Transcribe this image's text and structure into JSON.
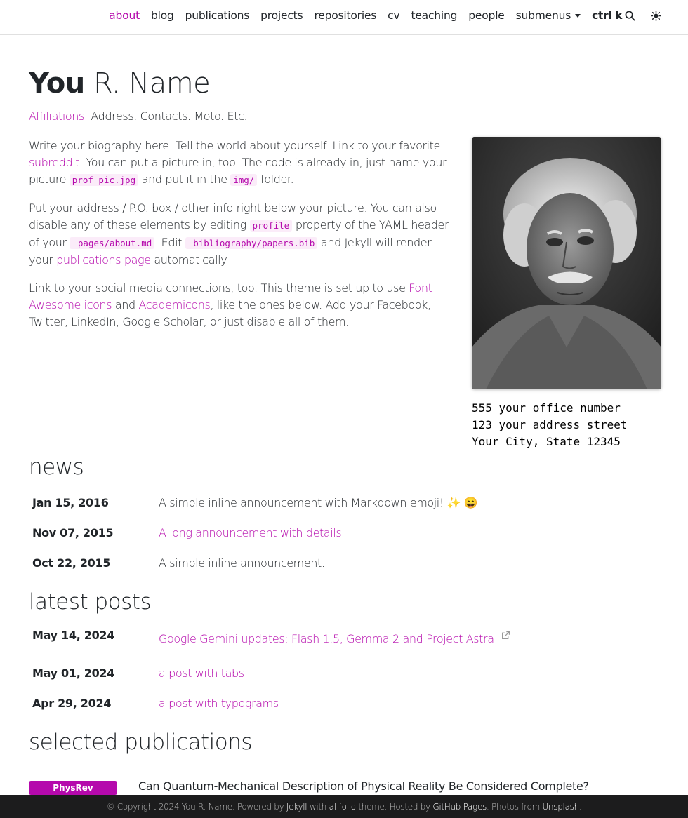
{
  "nav": {
    "items": [
      "about",
      "blog",
      "publications",
      "projects",
      "repositories",
      "cv",
      "teaching",
      "people"
    ],
    "submenus_label": "submenus",
    "search_label": "ctrl k",
    "accent": "#b509ac"
  },
  "header": {
    "first": "You",
    "rest": "R. Name",
    "affiliations_link": "Affiliations",
    "desc_rest": ". Address. Contacts. Moto. Etc."
  },
  "bio": {
    "p1_a": "Write your biography here. Tell the world about yourself. Link to your favorite ",
    "p1_link": "subreddit",
    "p1_b": ". You can put a picture in, too. The code is already in, just name your picture ",
    "p1_code1": "prof_pic.jpg",
    "p1_c": " and put it in the ",
    "p1_code2": "img/",
    "p1_d": " folder.",
    "p2_a": "Put your address / P.O. box / other info right below your picture. You can also disable any of these elements by editing ",
    "p2_code1": "profile",
    "p2_b": " property of the YAML header of your ",
    "p2_code2": "_pages/about.md",
    "p2_c": ". Edit ",
    "p2_code3": "_bibliography/papers.bib",
    "p2_d": " and Jekyll will render your ",
    "p2_link": "publications page",
    "p2_e": " automatically.",
    "p3_a": "Link to your social media connections, too. This theme is set up to use ",
    "p3_link1": "Font Awesome icons",
    "p3_b": " and ",
    "p3_link2": "Academicons",
    "p3_c": ", like the ones below. Add your Facebook, Twitter, LinkedIn, Google Scholar, or just disable all of them."
  },
  "address": {
    "line1": "555 your office number",
    "line2": "123 your address street",
    "line3": "Your City, State 12345"
  },
  "news": {
    "title": "news",
    "items": [
      {
        "date": "Jan 15, 2016",
        "text": "A simple inline announcement with Markdown emoji! ✨ 😄"
      },
      {
        "date": "Nov 07, 2015",
        "text": "A long announcement with details"
      },
      {
        "date": "Oct 22, 2015",
        "text": "A simple inline announcement."
      }
    ]
  },
  "posts": {
    "title": "latest posts",
    "items": [
      {
        "date": "May 14, 2024",
        "text": "Google Gemini updates: Flash 1.5, Gemma 2 and Project Astra"
      },
      {
        "date": "May 01, 2024",
        "text": "a post with tabs"
      },
      {
        "date": "Apr 29, 2024",
        "text": "a post with typograms"
      }
    ]
  },
  "publications": {
    "title": "selected publications",
    "items": [
      {
        "badge": "PhysRev",
        "title": "Can Quantum-Mechanical Description of Physical Reality Be Considered Complete?"
      }
    ]
  },
  "footer": {
    "a": "© Copyright 2024 You R. Name. Powered by ",
    "jekyll": "Jekyll",
    "b": " with ",
    "alfolio": "al-folio",
    "c": " theme. Hosted by ",
    "ghpages": "GitHub Pages",
    "d": ". Photos from ",
    "unsplash": "Unsplash",
    "e": "."
  }
}
